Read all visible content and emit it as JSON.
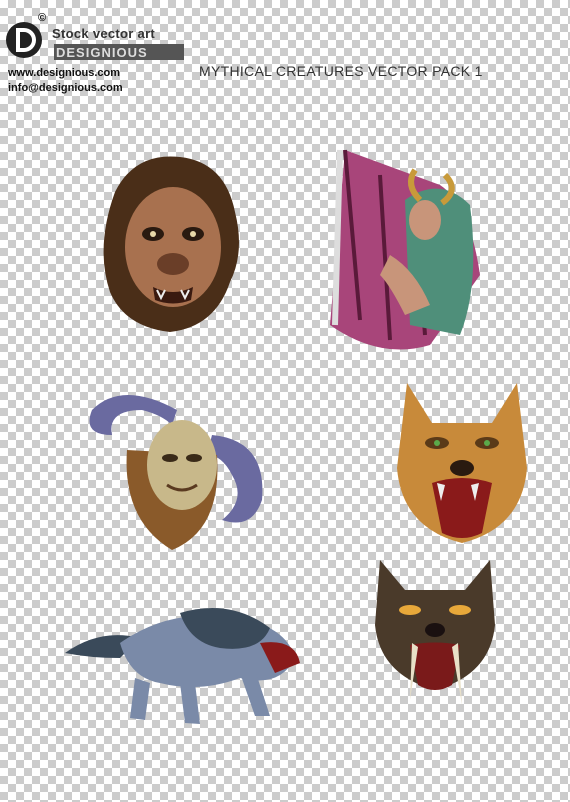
{
  "brand": {
    "copyright_mark": "©",
    "tagline": "Stock vector art",
    "logo_letter": "D",
    "logo_word": "DESIGNIOUS"
  },
  "contact": {
    "website": "www.designious.com",
    "email": "info@designious.com"
  },
  "title": "MYTHICAL CREATURES VECTOR PACK 1",
  "creatures": [
    {
      "name": "ape-man-head",
      "colors": {
        "fur": "#5a3a22",
        "skin": "#b07a5a"
      }
    },
    {
      "name": "winged-harpy",
      "colors": {
        "wing": "#a8457a",
        "hair": "#4f8f7a",
        "horn": "#c89a3a"
      }
    },
    {
      "name": "horned-satyr-head",
      "colors": {
        "horn": "#6a6aa0",
        "face": "#c8b88a",
        "beard": "#8a5a2a"
      }
    },
    {
      "name": "werewolf-head",
      "colors": {
        "fur": "#c88a3a",
        "mouth": "#8a1a1a"
      }
    },
    {
      "name": "werewolf-full-body",
      "colors": {
        "body": "#7a8aa8",
        "mane": "#3a4a5a"
      }
    },
    {
      "name": "sabertooth-head",
      "colors": {
        "fur": "#4a3a2a",
        "fang": "#e8e0c8"
      }
    }
  ]
}
